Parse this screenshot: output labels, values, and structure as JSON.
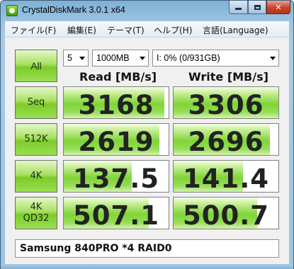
{
  "window": {
    "title": "CrystalDiskMark 3.0.1 x64",
    "close_label": "✕"
  },
  "menu": [
    {
      "label": "ファイル(F)"
    },
    {
      "label": "編集(E)"
    },
    {
      "label": "テーマ(T)"
    },
    {
      "label": "ヘルプ(H)"
    },
    {
      "label": "言語(Language)"
    }
  ],
  "controls": {
    "all_label": "All",
    "count": "5",
    "size": "1000MB",
    "drive": "I: 0% (0/931GB)"
  },
  "columns": {
    "read": "Read [MB/s]",
    "write": "Write [MB/s]"
  },
  "rows": [
    {
      "label1": "Seq",
      "label2": "",
      "read": "3168",
      "write": "3306",
      "read_level": 0.96,
      "write_level": 1.0
    },
    {
      "label1": "512K",
      "label2": "",
      "read": "2619",
      "write": "2696",
      "read_level": 0.91,
      "write_level": 0.92
    },
    {
      "label1": "4K",
      "label2": "",
      "read": "137.5",
      "write": "141.4",
      "read_level": 0.65,
      "write_level": 0.66
    },
    {
      "label1": "4K",
      "label2": "QD32",
      "read": "507.1",
      "write": "500.7",
      "read_level": 0.81,
      "write_level": 0.8
    }
  ],
  "comment": "Samsung 840PRO *4 RAID0",
  "colors": {
    "bar_green": "#7fd437",
    "button_green": "#9ade52",
    "frame_blue": "#9cc4e1"
  }
}
